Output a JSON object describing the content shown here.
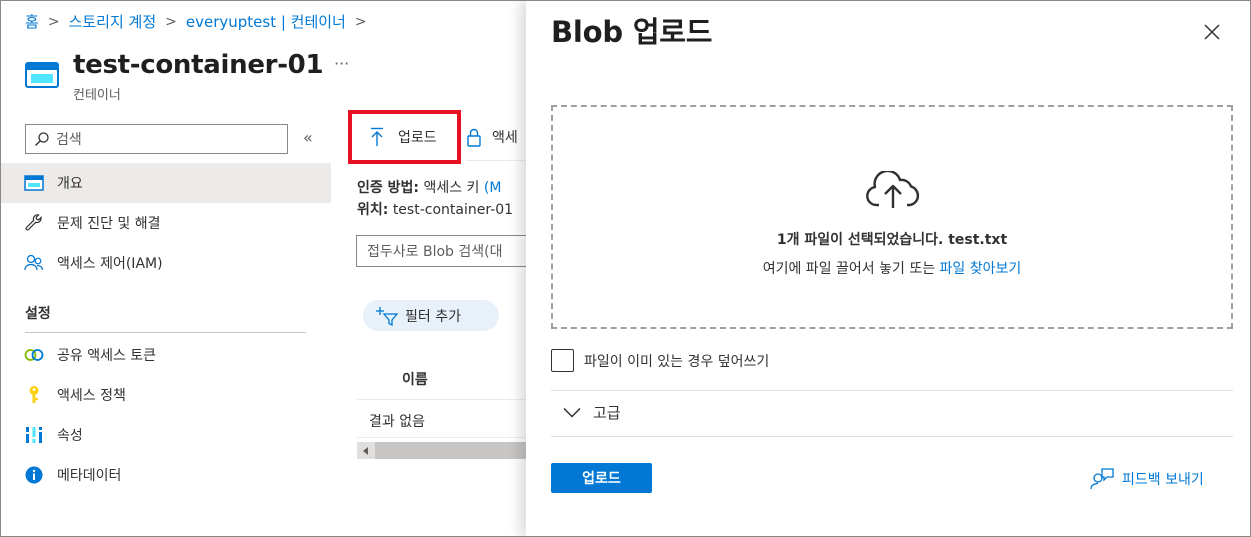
{
  "breadcrumb": {
    "items": [
      "홈",
      "스토리지 계정",
      "everyuptest | 컨테이너"
    ],
    "separator": ">"
  },
  "header": {
    "title": "test-container-01",
    "subtitle": "컨테이너",
    "more": "···"
  },
  "sidebar": {
    "search_placeholder": "검색",
    "collapse": "«",
    "items": [
      {
        "label": "개요",
        "icon": "overview-icon",
        "active": true
      },
      {
        "label": "문제 진단 및 해결",
        "icon": "wrench-icon"
      },
      {
        "label": "액세스 제어(IAM)",
        "icon": "people-icon"
      }
    ],
    "section_title": "설정",
    "settings_items": [
      {
        "label": "공유 액세스 토큰",
        "icon": "link-icon"
      },
      {
        "label": "액세스 정책",
        "icon": "key-icon"
      },
      {
        "label": "속성",
        "icon": "properties-icon"
      },
      {
        "label": "메타데이터",
        "icon": "info-icon"
      }
    ]
  },
  "toolbar": {
    "upload_label": "업로드",
    "access_label": "액세"
  },
  "info": {
    "auth_label": "인증 방법:",
    "auth_value": "액세스 키",
    "auth_link": "(M",
    "location_label": "위치:",
    "location_value": "test-container-01"
  },
  "blob_search": {
    "placeholder": "접두사로 Blob 검색(대"
  },
  "filter": {
    "label": "필터 추가"
  },
  "table": {
    "column_name": "이름",
    "empty_text": "결과 없음"
  },
  "panel": {
    "title": "Blob 업로드",
    "close": "close-icon",
    "dropzone": {
      "selected_text": "1개 파일이 선택되었습니다. test.txt",
      "hint_text": "여기에 파일 끌어서 놓기 또는",
      "browse_link": "파일 찾아보기"
    },
    "overwrite_label": "파일이 이미 있는 경우 덮어쓰기",
    "overwrite_checked": false,
    "advanced_label": "고급",
    "upload_button": "업로드",
    "feedback_label": "피드백 보내기"
  },
  "colors": {
    "accent": "#0078d4",
    "highlight_border": "#e81123",
    "active_nav": "#edebe9"
  }
}
